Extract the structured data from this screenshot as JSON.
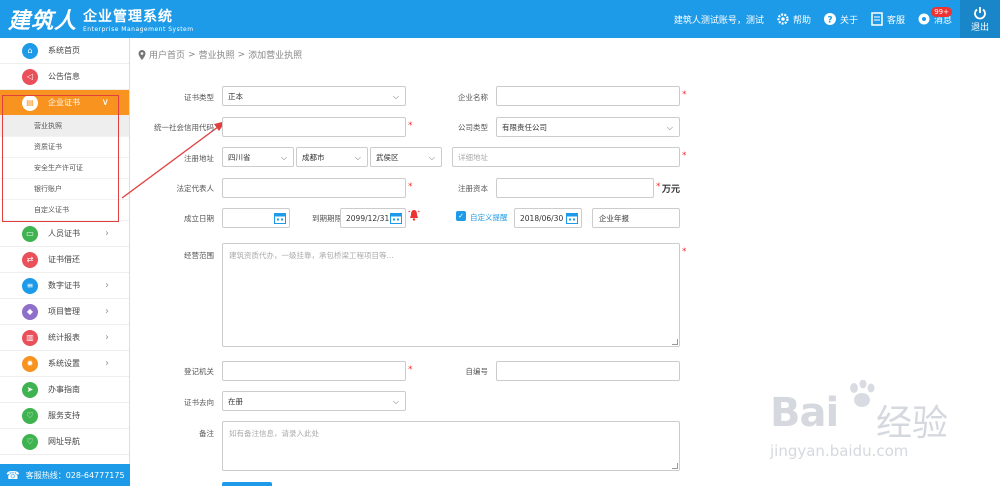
{
  "header": {
    "logo_main": "建筑人",
    "logo_title": "企业管理系统",
    "logo_subtitle": "Enterprise Management System",
    "account": "建筑人测试账号，测试",
    "help": "帮助",
    "about": "关于",
    "service": "客服",
    "message": "消息",
    "message_badge": "99+",
    "exit": "退出"
  },
  "sidebar": {
    "items": [
      {
        "label": "系统首页",
        "color": "#1e9be8"
      },
      {
        "label": "公告信息",
        "color": "#e9505a"
      },
      {
        "label": "企业证书",
        "color": "#f7931e"
      },
      {
        "label": "人员证书",
        "color": "#3fb34f"
      },
      {
        "label": "证书借还",
        "color": "#e9505a"
      },
      {
        "label": "数字证书",
        "color": "#1e9be8"
      },
      {
        "label": "项目管理",
        "color": "#8e6fc9"
      },
      {
        "label": "统计报表",
        "color": "#e9505a"
      },
      {
        "label": "系统设置",
        "color": "#f7931e"
      },
      {
        "label": "办事指南",
        "color": "#3fb34f"
      },
      {
        "label": "服务支持",
        "color": "#3fb34f"
      },
      {
        "label": "网址导航",
        "color": "#3fb34f"
      }
    ],
    "submenu": [
      "营业执照",
      "资质证书",
      "安全生产许可证",
      "银行账户",
      "自定义证书"
    ],
    "hotline": "客服热线：028-64777175"
  },
  "breadcrumb": {
    "home": "用户首页",
    "sep": ">",
    "section": "营业执照",
    "page": "添加营业执照"
  },
  "form": {
    "cert_type_label": "证书类型",
    "cert_type_value": "正本",
    "company_name_label": "企业名称",
    "credit_code_label": "统一社会信用代码",
    "company_type_label": "公司类型",
    "company_type_value": "有限责任公司",
    "address_label": "注册地址",
    "province": "四川省",
    "city": "成都市",
    "district": "武侯区",
    "address_placeholder": "详细地址",
    "legal_rep_label": "法定代表人",
    "capital_label": "注册资本",
    "capital_unit": "万元",
    "found_date_label": "成立日期",
    "expiry_label": "到期期限",
    "expiry_value": "2099/12/31",
    "custom_remind_label": "自定义提醒",
    "remind_date": "2018/06/30",
    "remind_text": "企业年报",
    "scope_label": "经营范围",
    "scope_placeholder": "建筑资质代办，一级挂靠，承包桥梁工程项目等...",
    "reg_authority_label": "登记机关",
    "code_label": "自编号",
    "direction_label": "证书去向",
    "direction_value": "在册",
    "remark_label": "备注",
    "remark_placeholder": "如有备注信息，请录入此处",
    "required_mark": "*"
  },
  "watermark": {
    "brand": "Bai",
    "brand_cn": "经验",
    "url": "jingyan.baidu.com"
  }
}
